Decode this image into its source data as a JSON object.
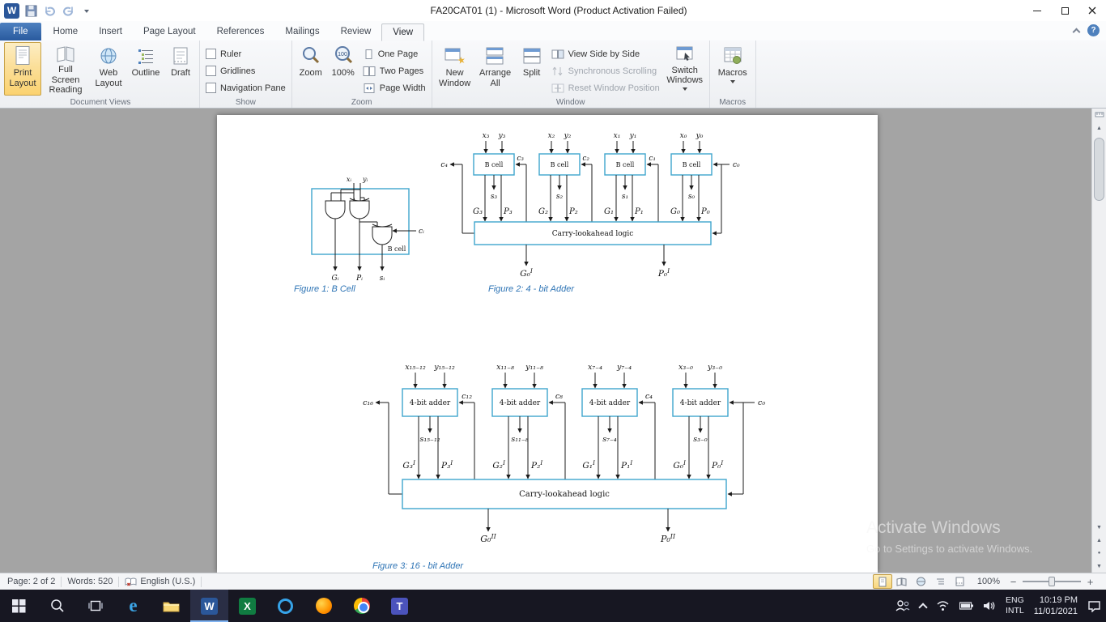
{
  "window": {
    "title": "FA20CAT01 (1) - Microsoft Word (Product Activation Failed)"
  },
  "tabs": {
    "file": "File",
    "home": "Home",
    "insert": "Insert",
    "page_layout": "Page Layout",
    "references": "References",
    "mailings": "Mailings",
    "review": "Review",
    "view": "View"
  },
  "ribbon": {
    "document_views": {
      "label": "Document Views",
      "print_layout": "Print Layout",
      "full_screen_reading": "Full Screen Reading",
      "web_layout": "Web Layout",
      "outline": "Outline",
      "draft": "Draft"
    },
    "show": {
      "label": "Show",
      "ruler": "Ruler",
      "gridlines": "Gridlines",
      "navigation_pane": "Navigation Pane"
    },
    "zoom": {
      "label": "Zoom",
      "zoom": "Zoom",
      "hundred": "100%",
      "icon_hundred": "100",
      "one_page": "One Page",
      "two_pages": "Two Pages",
      "page_width": "Page Width"
    },
    "window": {
      "label": "Window",
      "new_window": "New Window",
      "arrange_all": "Arrange All",
      "split": "Split",
      "view_side_by_side": "View Side by Side",
      "synchronous_scrolling": "Synchronous Scrolling",
      "reset_window_position": "Reset Window Position",
      "switch_windows": "Switch Windows"
    },
    "macros": {
      "label": "Macros",
      "macros": "Macros"
    }
  },
  "figures": {
    "figure1": {
      "caption": "Figure 1: B Cell",
      "box_label": "B cell",
      "input_x": "xᵢ",
      "input_y": "yᵢ",
      "carry_in": "cᵢ",
      "out_g": "Gᵢ",
      "out_p": "Pᵢ",
      "out_s": "sᵢ"
    },
    "figure2": {
      "caption": "Figure 2: 4 - bit Adder",
      "cell_label": "B cell",
      "cells": [
        {
          "x": "x₃",
          "y": "y₃",
          "s": "s₃",
          "g": "G₃",
          "p": "P₃"
        },
        {
          "x": "x₂",
          "y": "y₂",
          "s": "s₂",
          "g": "G₂",
          "p": "P₂"
        },
        {
          "x": "x₁",
          "y": "y₁",
          "s": "s₁",
          "g": "G₁",
          "p": "P₁"
        },
        {
          "x": "x₀",
          "y": "y₀",
          "s": "s₀",
          "g": "G₀",
          "p": "P₀"
        }
      ],
      "carry_out": "c₄",
      "carries_mid": [
        "c₃",
        "c₂",
        "c₁"
      ],
      "carry_in": "c₀",
      "cla_label": "Carry-lookahead logic",
      "out_g": "G₀^I",
      "out_p": "P₀^I"
    },
    "figure3": {
      "caption": "Figure 3: 16 - bit Adder",
      "cell_label": "4-bit adder",
      "cells": [
        {
          "x": "x₁₅₋₁₂",
          "y": "y₁₅₋₁₂",
          "s": "s₁₅₋₁₂",
          "g": "G₃^I",
          "p": "P₃^I"
        },
        {
          "x": "x₁₁₋₈",
          "y": "y₁₁₋₈",
          "s": "s₁₁₋₈",
          "g": "G₂^I",
          "p": "P₂^I"
        },
        {
          "x": "x₇₋₄",
          "y": "y₇₋₄",
          "s": "s₇₋₄",
          "g": "G₁^I",
          "p": "P₁^I"
        },
        {
          "x": "x₃₋₀",
          "y": "y₃₋₀",
          "s": "s₃₋₀",
          "g": "G₀^I",
          "p": "P₀^I"
        }
      ],
      "carry_out": "c₁₆",
      "carries_mid": [
        "c₁₂",
        "c₈",
        "c₄"
      ],
      "carry_in": "c₀",
      "cla_label": "Carry-lookahead logic",
      "out_g": "G₀^II",
      "out_p": "P₀^II"
    }
  },
  "statusbar": {
    "page": "Page: 2 of 2",
    "words": "Words: 520",
    "language": "English (U.S.)",
    "zoom_level": "100%"
  },
  "watermark": {
    "line1": "Activate Windows",
    "line2": "Go to Settings to activate Windows."
  },
  "taskbar": {
    "lang_top": "ENG",
    "lang_bottom": "INTL",
    "time": "10:19 PM",
    "date": "11/01/2021"
  },
  "colors": {
    "accent_blue": "#2b579a",
    "selected_amber": "#fbd270",
    "caption_blue": "#2e74b5",
    "figure_box_stroke": "#3ea6cd"
  },
  "icons": [
    "word-app-icon",
    "save-icon",
    "undo-icon",
    "repeat-icon",
    "help-icon",
    "ribbon-collapse-icon",
    "print-layout-icon",
    "full-screen-reading-icon",
    "web-layout-icon",
    "outline-icon",
    "draft-icon",
    "zoom-icon",
    "zoom-100-icon",
    "one-page-icon",
    "two-pages-icon",
    "page-width-icon",
    "new-window-icon",
    "arrange-all-icon",
    "split-icon",
    "side-by-side-icon",
    "sync-scroll-icon",
    "reset-position-icon",
    "switch-windows-icon",
    "macros-icon",
    "proofing-error-icon",
    "ruler-toggle-icon",
    "start-icon",
    "search-icon",
    "task-view-icon",
    "edge-icon",
    "explorer-icon",
    "word-icon",
    "excel-icon",
    "browser-icon",
    "firefox-icon",
    "chrome-icon",
    "teams-icon",
    "people-icon",
    "hidden-icons-chevron",
    "wifi-icon",
    "battery-icon",
    "speaker-icon",
    "notification-icon"
  ]
}
